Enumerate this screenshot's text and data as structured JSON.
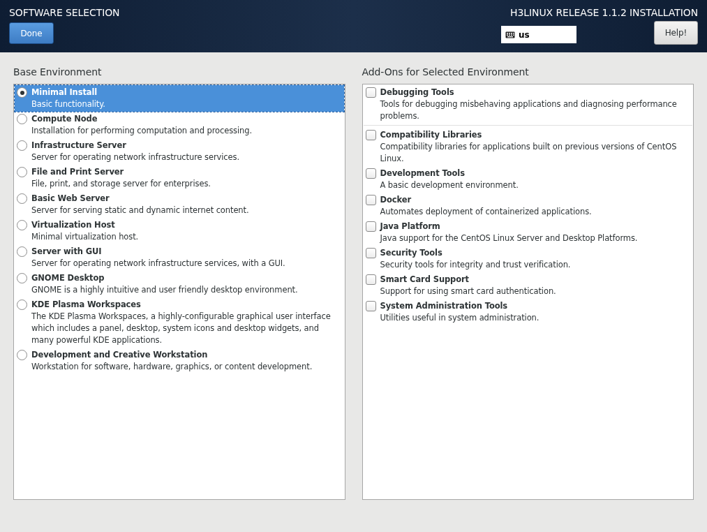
{
  "header": {
    "title": "SOFTWARE SELECTION",
    "done_button": "Done",
    "product": "H3LINUX RELEASE 1.1.2 INSTALLATION",
    "keyboard_layout": "us",
    "help_button": "Help!"
  },
  "base_environment": {
    "heading": "Base Environment",
    "items": [
      {
        "name": "Minimal Install",
        "description": "Basic functionality.",
        "selected": true
      },
      {
        "name": "Compute Node",
        "description": "Installation for performing computation and processing.",
        "selected": false
      },
      {
        "name": "Infrastructure Server",
        "description": "Server for operating network infrastructure services.",
        "selected": false
      },
      {
        "name": "File and Print Server",
        "description": "File, print, and storage server for enterprises.",
        "selected": false
      },
      {
        "name": "Basic Web Server",
        "description": "Server for serving static and dynamic internet content.",
        "selected": false
      },
      {
        "name": "Virtualization Host",
        "description": "Minimal virtualization host.",
        "selected": false
      },
      {
        "name": "Server with GUI",
        "description": "Server for operating network infrastructure services, with a GUI.",
        "selected": false
      },
      {
        "name": "GNOME Desktop",
        "description": "GNOME is a highly intuitive and user friendly desktop environment.",
        "selected": false
      },
      {
        "name": "KDE Plasma Workspaces",
        "description": "The KDE Plasma Workspaces, a highly-configurable graphical user interface which includes a panel, desktop, system icons and desktop widgets, and many powerful KDE applications.",
        "selected": false
      },
      {
        "name": "Development and Creative Workstation",
        "description": "Workstation for software, hardware, graphics, or content development.",
        "selected": false
      }
    ]
  },
  "add_ons": {
    "heading": "Add-Ons for Selected Environment",
    "items": [
      {
        "name": "Debugging Tools",
        "description": "Tools for debugging misbehaving applications and diagnosing performance problems.",
        "checked": false,
        "separator_after": true
      },
      {
        "name": "Compatibility Libraries",
        "description": "Compatibility libraries for applications built on previous versions of CentOS Linux.",
        "checked": false,
        "separator_after": false
      },
      {
        "name": "Development Tools",
        "description": "A basic development environment.",
        "checked": false,
        "separator_after": false
      },
      {
        "name": "Docker",
        "description": "Automates deployment of containerized applications.",
        "checked": false,
        "separator_after": false
      },
      {
        "name": "Java Platform",
        "description": "Java support for the CentOS Linux Server and Desktop Platforms.",
        "checked": false,
        "separator_after": false
      },
      {
        "name": "Security Tools",
        "description": "Security tools for integrity and trust verification.",
        "checked": false,
        "separator_after": false
      },
      {
        "name": "Smart Card Support",
        "description": "Support for using smart card authentication.",
        "checked": false,
        "separator_after": false
      },
      {
        "name": "System Administration Tools",
        "description": "Utilities useful in system administration.",
        "checked": false,
        "separator_after": false
      }
    ]
  }
}
